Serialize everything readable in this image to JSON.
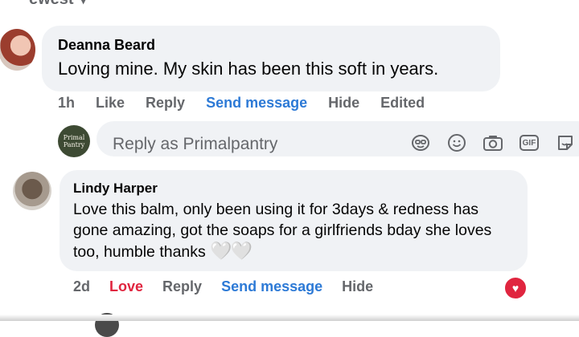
{
  "header": {
    "sort_label": "ewest"
  },
  "comments": [
    {
      "author": "Deanna Beard",
      "text": "Loving mine. My skin has been this soft in years.",
      "time": "1h",
      "actions": {
        "like": "Like",
        "reply": "Reply",
        "send_message": "Send message",
        "hide": "Hide",
        "edited": "Edited"
      }
    },
    {
      "author": "Lindy Harper",
      "text": "Love this balm, only been using it for 3days & redness has gone amazing, got the soaps for a girlfriends bday she loves too, humble thanks",
      "emoji": "🤍🤍",
      "time": "2d",
      "actions": {
        "love": "Love",
        "reply": "Reply",
        "send_message": "Send message",
        "hide": "Hide"
      }
    }
  ],
  "reply_box": {
    "placeholder": "Reply as Primalpantry",
    "avatar_text": "Primal Pantry",
    "tools": [
      "avatar-sticker-icon",
      "emoji-icon",
      "camera-icon",
      "gif-icon",
      "sticker-icon"
    ],
    "gif_label": "GIF"
  },
  "colors": {
    "link": "#2d7ad6",
    "love": "#e0253f",
    "bubble": "#f0f2f5",
    "meta": "#65676b"
  }
}
